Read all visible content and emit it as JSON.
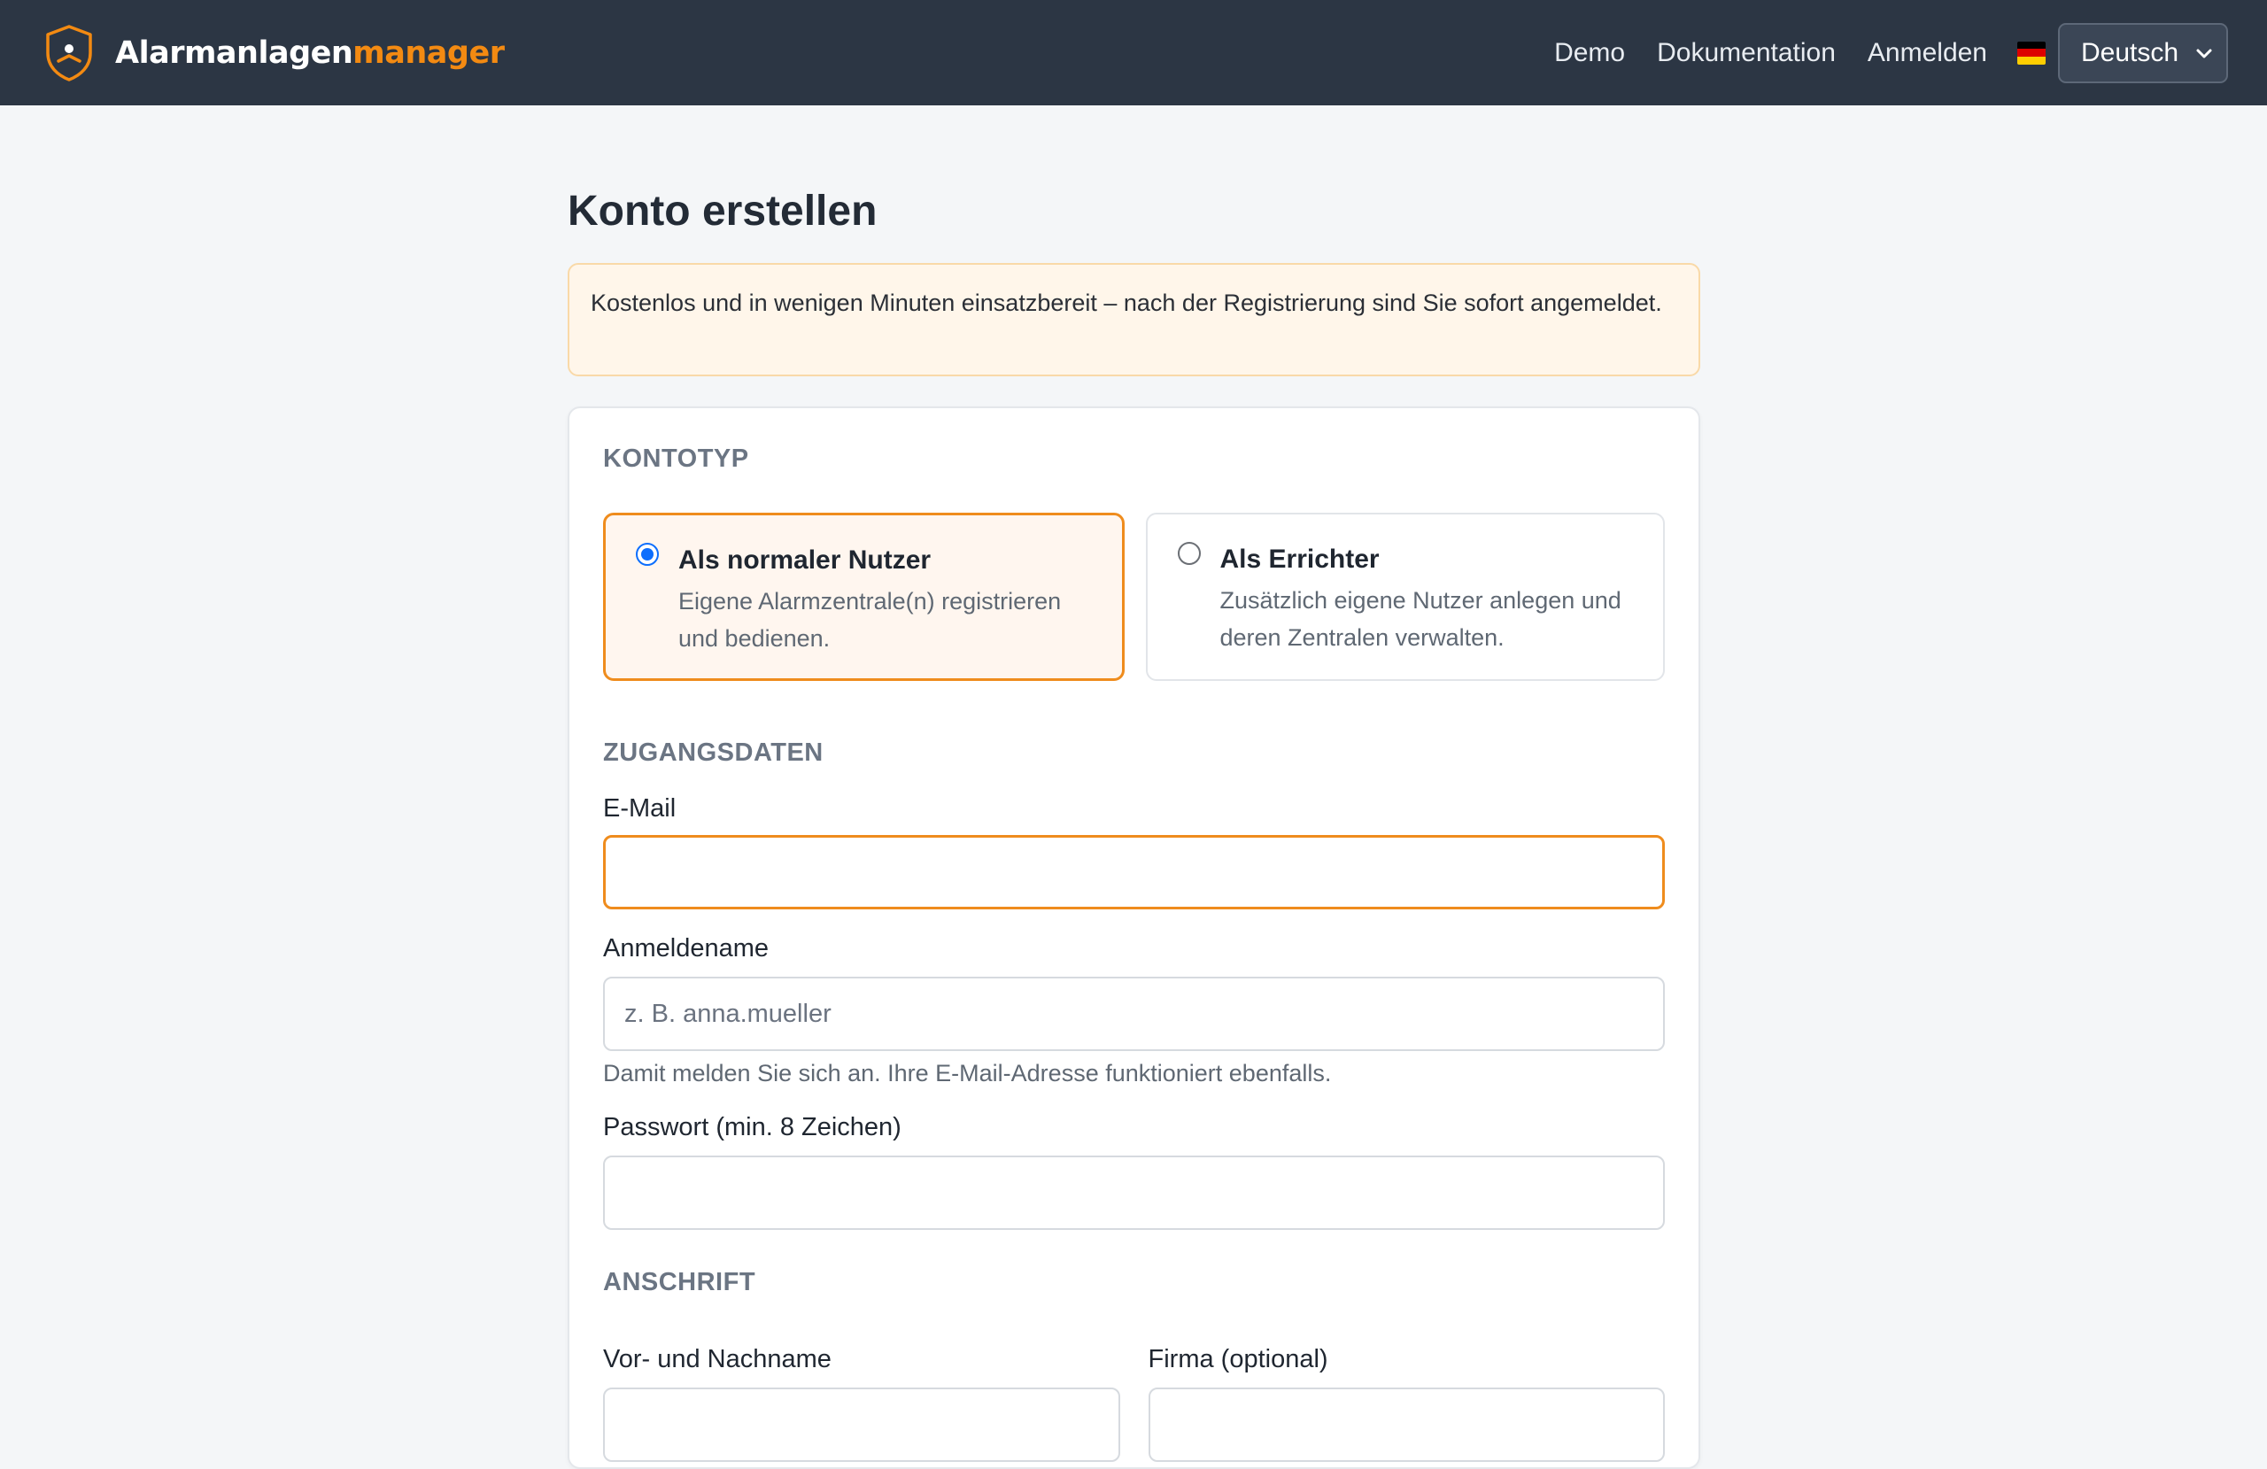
{
  "navbar": {
    "brand_primary": "Alarmanlagen",
    "brand_accent": "manager",
    "logo_icon": "shield-person-icon",
    "links": [
      {
        "label": "Demo"
      },
      {
        "label": "Dokumentation"
      },
      {
        "label": "Anmelden"
      }
    ],
    "language": {
      "flag_icon": "german-flag-icon",
      "selected": "Deutsch"
    }
  },
  "page": {
    "title": "Konto erstellen",
    "notice": "Kostenlos und in wenigen Minuten einsatzbereit – nach der Registrierung sind Sie sofort angemeldet."
  },
  "form": {
    "account_type": {
      "section_title": "KONTOTYP",
      "options": [
        {
          "title": "Als normaler Nutzer",
          "description": "Eigene Alarmzentrale(n) registrieren und bedienen.",
          "selected": true
        },
        {
          "title": "Als Errichter",
          "description": "Zusätzlich eigene Nutzer anlegen und deren Zentralen verwalten.",
          "selected": false
        }
      ]
    },
    "credentials": {
      "section_title": "ZUGANGSDATEN",
      "email": {
        "label": "E-Mail",
        "value": "",
        "placeholder": ""
      },
      "username": {
        "label": "Anmeldename",
        "value": "",
        "placeholder": "z. B. anna.mueller",
        "help": "Damit melden Sie sich an. Ihre E-Mail-Adresse funktioniert ebenfalls."
      },
      "password": {
        "label": "Passwort (min. 8 Zeichen)",
        "value": "",
        "placeholder": ""
      }
    },
    "address": {
      "section_title": "ANSCHRIFT",
      "full_name": {
        "label": "Vor- und Nachname",
        "value": "",
        "placeholder": ""
      },
      "company": {
        "label": "Firma (optional)",
        "value": "",
        "placeholder": ""
      }
    }
  },
  "colors": {
    "navbar_bg": "#2c3644",
    "accent": "#f38a12",
    "radio_checked": "#0d6efd",
    "notice_bg": "#fff6ea",
    "page_bg": "#f4f6f8"
  }
}
